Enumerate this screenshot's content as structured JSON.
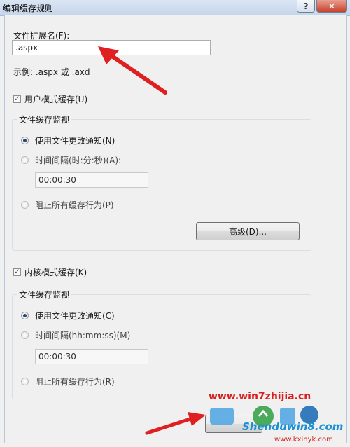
{
  "window": {
    "title": "编辑缓存规则",
    "help_glyph": "?",
    "close_glyph": "✕"
  },
  "extension": {
    "label": "文件扩展名(F):",
    "value": ".aspx",
    "example": "示例: .aspx 或 .axd"
  },
  "user_mode": {
    "checkbox_label": "用户模式缓存(U)",
    "checked": true,
    "check_glyph": "✓",
    "group_label": "文件缓存监视",
    "radio1": "使用文件更改通知(N)",
    "radio2": "时间间隔(时:分:秒)(A):",
    "interval_value": "00:00:30",
    "radio3": "阻止所有缓存行为(P)",
    "selected": "radio1",
    "advanced_button": "高级(D)..."
  },
  "kernel_mode": {
    "checkbox_label": "内核模式缓存(K)",
    "checked": true,
    "check_glyph": "✓",
    "group_label": "文件缓存监视",
    "radio1": "使用文件更改通知(C)",
    "radio2": "时间间隔(hh:mm:ss)(M)",
    "interval_value": "00:00:30",
    "radio3": "阻止所有缓存行为(R)",
    "selected": "radio1"
  },
  "watermarks": {
    "url1": "www.win7zhijia.cn",
    "url2": "Shenduwin8.com",
    "url3": "www.kxinyk.com"
  },
  "colors": {
    "arrow": "#e02020",
    "accent": "#27467d"
  }
}
